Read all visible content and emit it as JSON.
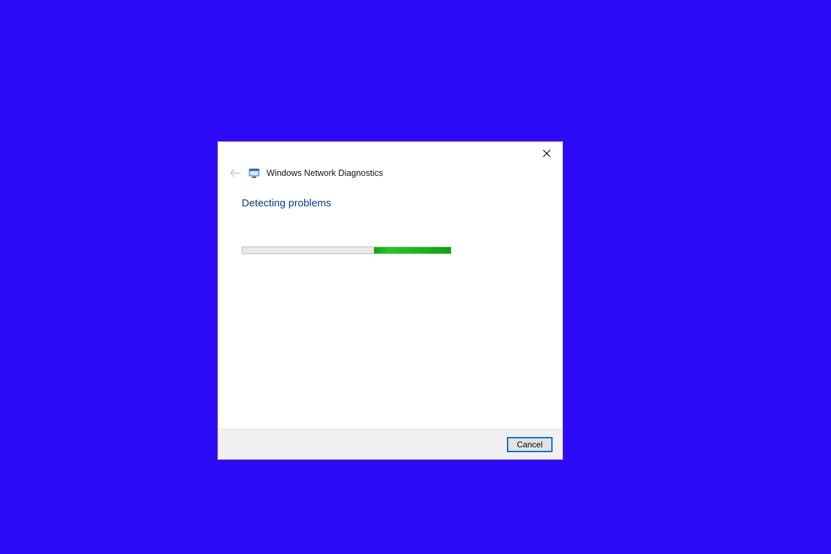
{
  "dialog": {
    "title": "Windows Network Diagnostics",
    "subtitle": "Detecting problems",
    "cancel_label": "Cancel"
  },
  "colors": {
    "background": "#2d0bf9",
    "accent_text": "#003a8a",
    "progress_fill": "#0fa60f"
  }
}
